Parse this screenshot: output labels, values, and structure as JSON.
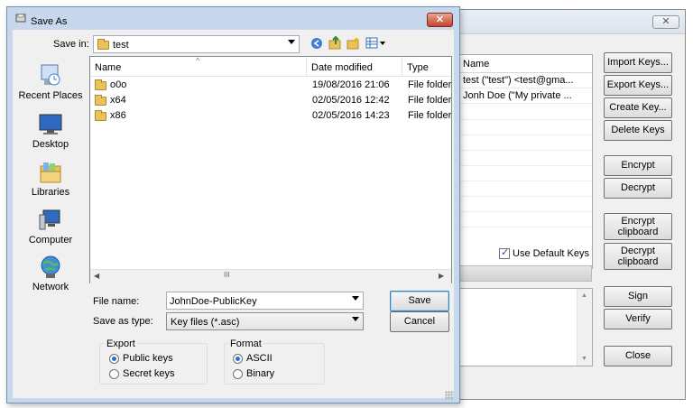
{
  "main_window": {
    "list_header": "Name",
    "keys": [
      "test (\"test\") <test@gma...",
      "Jonh Doe (\"My private ..."
    ],
    "buttons": {
      "import_keys": "Import Keys...",
      "export_keys": "Export Keys...",
      "create_key": "Create Key...",
      "delete_keys": "Delete Keys",
      "encrypt": "Encrypt",
      "decrypt": "Decrypt",
      "encrypt_clipboard_1": "Encrypt",
      "encrypt_clipboard_2": "clipboard",
      "decrypt_clipboard_1": "Decrypt",
      "decrypt_clipboard_2": "clipboard",
      "sign": "Sign",
      "verify": "Verify",
      "close": "Close"
    },
    "use_default_keys": "Use Default Keys",
    "use_default_keys_checked": true
  },
  "dialog": {
    "title": "Save As",
    "save_in_label": "Save in:",
    "save_in_value": "test",
    "places": [
      "Recent Places",
      "Desktop",
      "Libraries",
      "Computer",
      "Network"
    ],
    "columns": [
      "Name",
      "Date modified",
      "Type"
    ],
    "files": [
      {
        "name": "o0o",
        "date": "19/08/2016 21:06",
        "type": "File folder"
      },
      {
        "name": "x64",
        "date": "02/05/2016 12:42",
        "type": "File folder"
      },
      {
        "name": "x86",
        "date": "02/05/2016 14:23",
        "type": "File folder"
      }
    ],
    "scroll_grip": "III",
    "file_name_label": "File name:",
    "file_name_value": "JohnDoe-PublicKey",
    "save_type_label": "Save as type:",
    "save_type_value": "Key files (*.asc)",
    "save_button": "Save",
    "cancel_button": "Cancel",
    "export_group": {
      "title": "Export",
      "options": [
        "Public keys",
        "Secret keys"
      ],
      "selected": "Public keys"
    },
    "format_group": {
      "title": "Format",
      "options": [
        "ASCII",
        "Binary"
      ],
      "selected": "ASCII"
    }
  }
}
